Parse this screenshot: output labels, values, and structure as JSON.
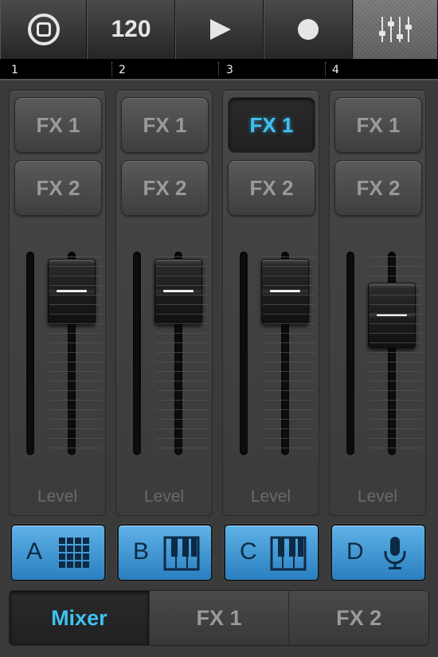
{
  "toolbar": {
    "loop_icon": "loop-stop-icon",
    "tempo": "120",
    "play_icon": "play-icon",
    "record_icon": "record-icon",
    "mixer_icon": "mixer-sliders-icon"
  },
  "ruler": {
    "bars": [
      "1",
      "2",
      "3",
      "4"
    ]
  },
  "channels": [
    {
      "fx1": "FX 1",
      "fx2": "FX 2",
      "level_label": "Level",
      "fx1_active": false,
      "fader_level": 0.9
    },
    {
      "fx1": "FX 1",
      "fx2": "FX 2",
      "level_label": "Level",
      "fx1_active": false,
      "fader_level": 0.9
    },
    {
      "fx1": "FX 1",
      "fx2": "FX 2",
      "level_label": "Level",
      "fx1_active": true,
      "fader_level": 0.9
    },
    {
      "fx1": "FX 1",
      "fx2": "FX 2",
      "level_label": "Level",
      "fx1_active": false,
      "fader_level": 0.75
    }
  ],
  "tracks": [
    {
      "letter": "A",
      "icon": "drum-grid-icon"
    },
    {
      "letter": "B",
      "icon": "keyboard-icon"
    },
    {
      "letter": "C",
      "icon": "keyboard-icon"
    },
    {
      "letter": "D",
      "icon": "microphone-icon"
    }
  ],
  "tabs": [
    {
      "label": "Mixer",
      "active": true
    },
    {
      "label": "FX 1",
      "active": false
    },
    {
      "label": "FX 2",
      "active": false
    }
  ],
  "colors": {
    "accent": "#3ec3f4",
    "track_button": "#3a93d4"
  }
}
